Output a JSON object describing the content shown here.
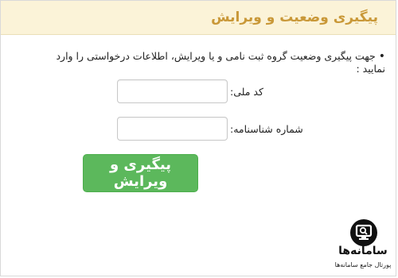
{
  "header": {
    "title": "پیگیری وضعیت و ویرایش"
  },
  "form": {
    "instruction": "جهت پیگیری وضعیت گروه ثبت نامی و یا ویرایش، اطلاعات درخواستی را وارد نمایید :",
    "national_code_label": "کد ملی:",
    "national_code_value": "",
    "birth_certificate_label": "شماره شناسنامه:",
    "birth_certificate_value": "",
    "submit_label": "پیگیری و ویرایش"
  },
  "watermark": {
    "name": "سامانه‌ها",
    "tagline": "پورتال جامع سامانه‌ها",
    "icon": "monitor-search-icon"
  },
  "colors": {
    "header_bg": "#fbf3d8",
    "header_text": "#c99838",
    "button_bg": "#5cb85c"
  }
}
